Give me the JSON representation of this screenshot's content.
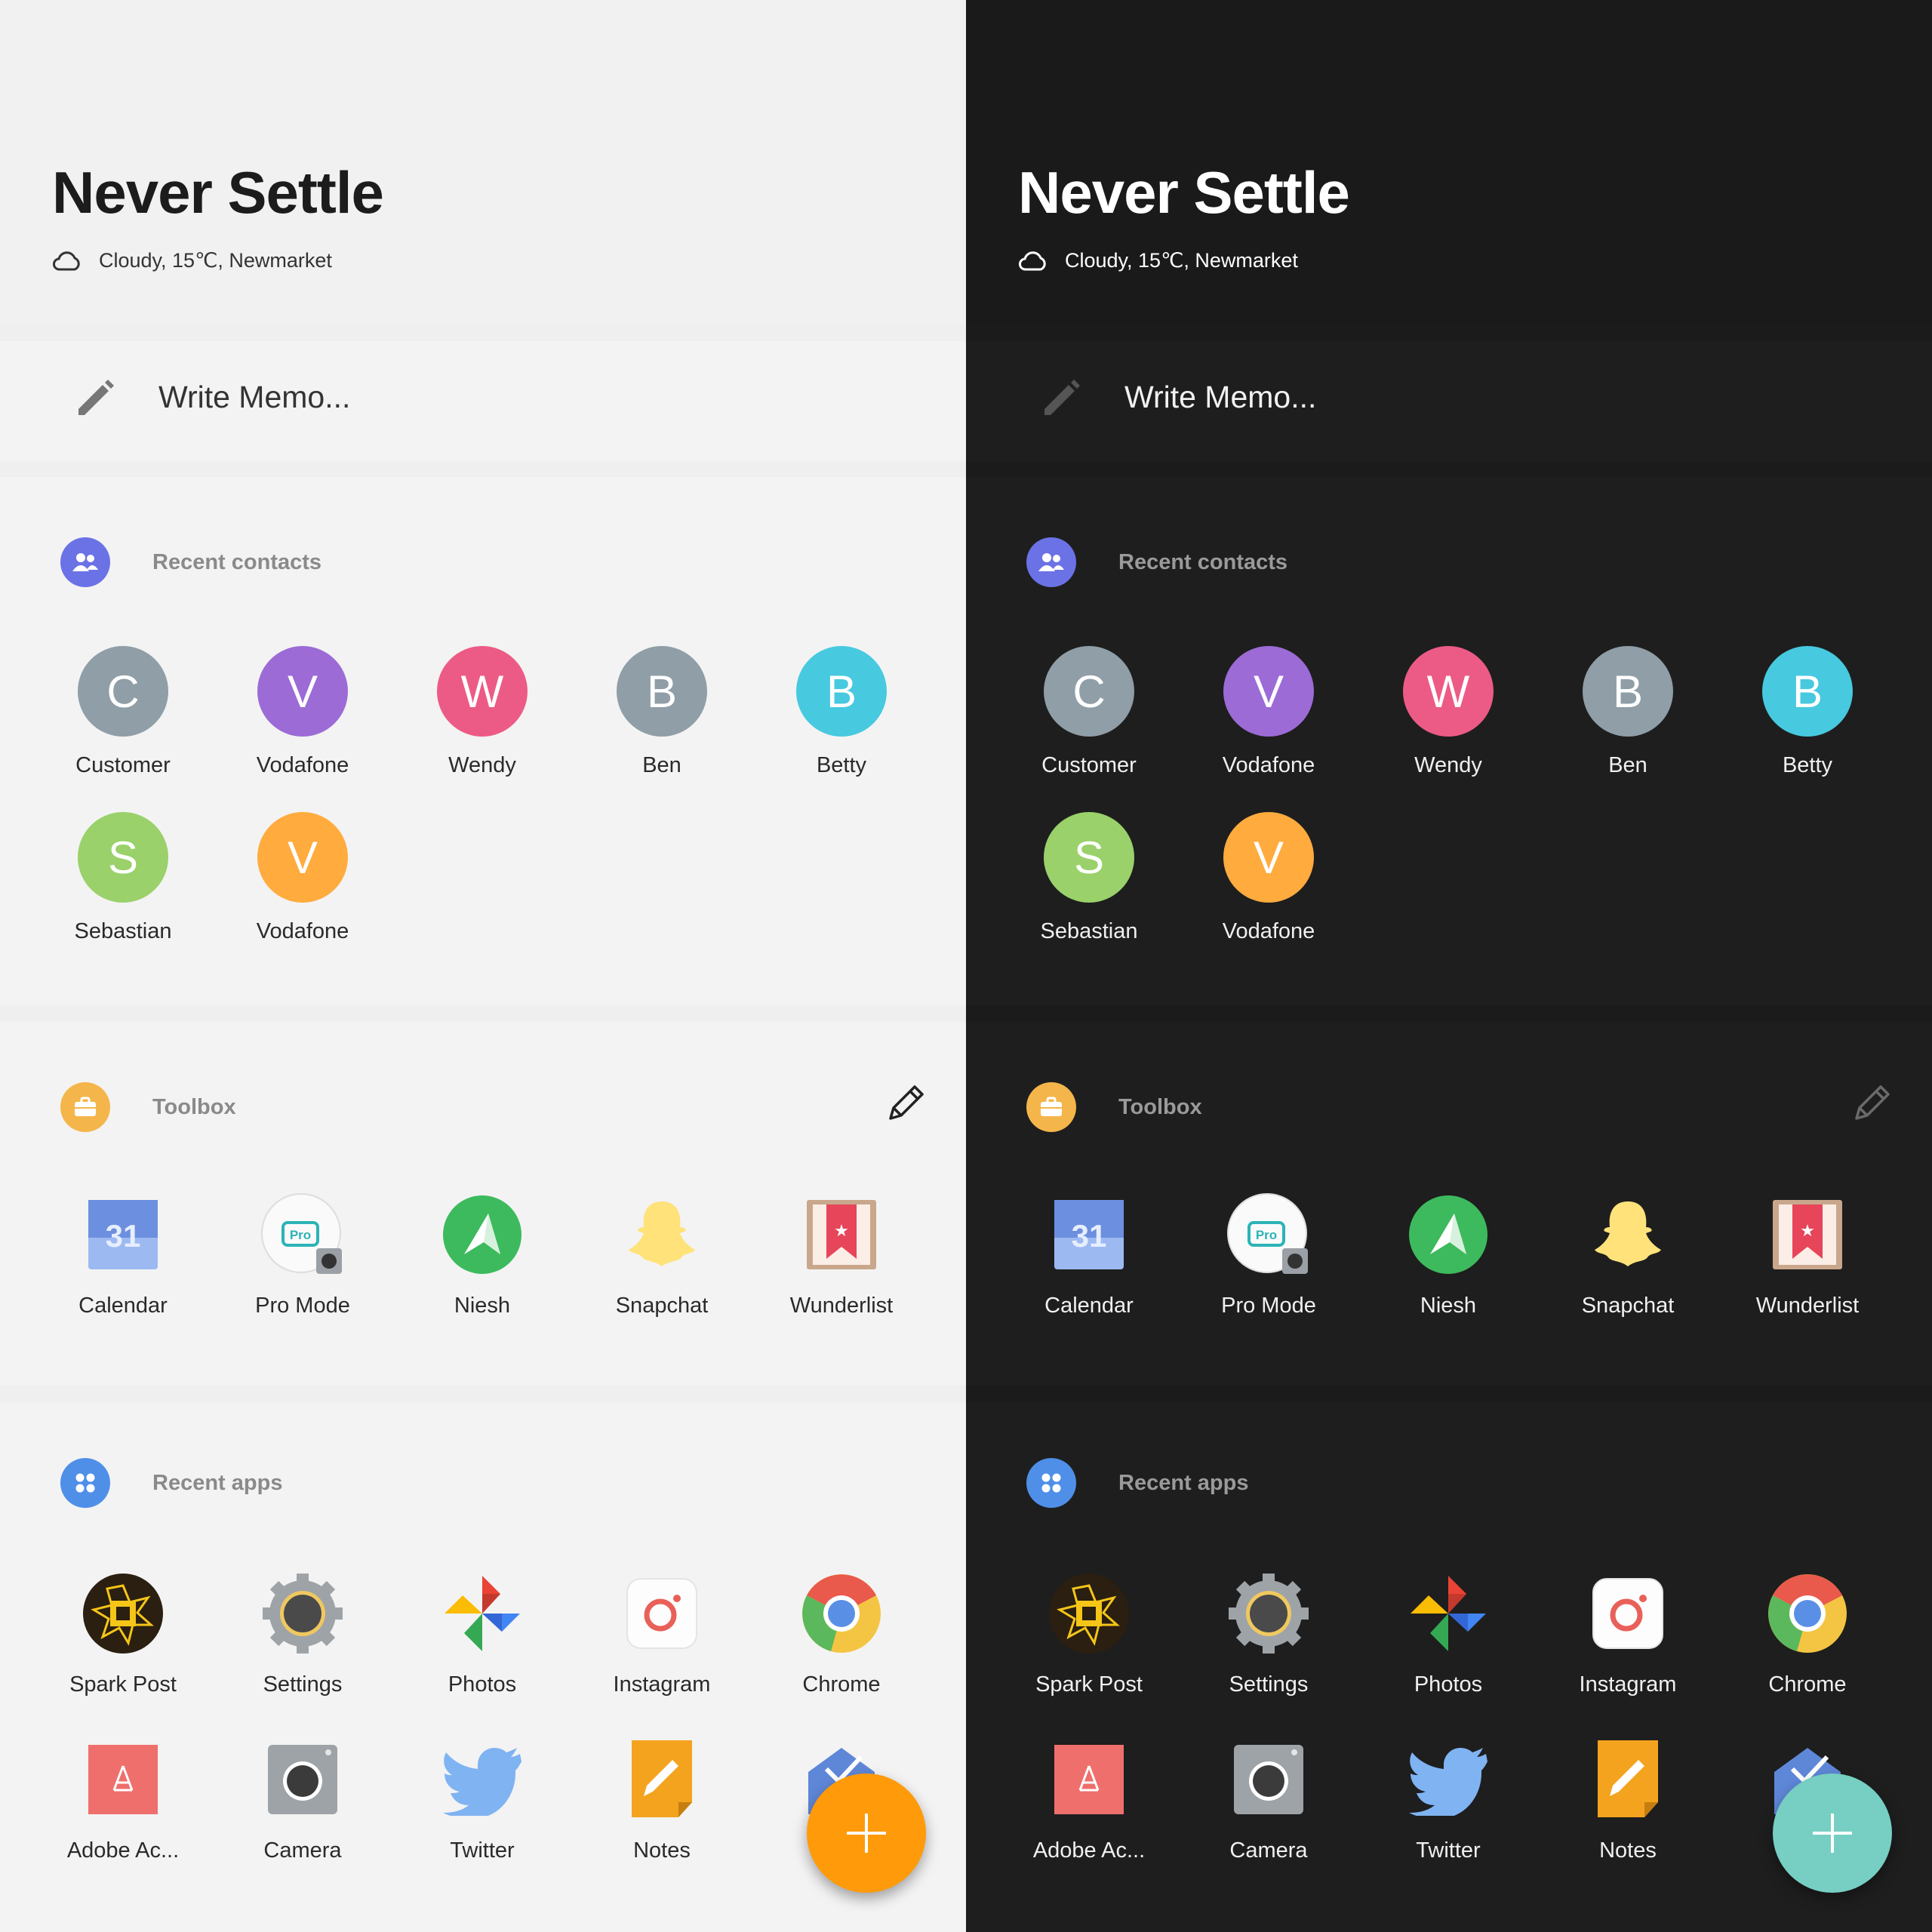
{
  "header": {
    "title": "Never Settle",
    "weather": "Cloudy, 15℃, Newmarket",
    "weather_icon": "cloud-icon"
  },
  "memo": {
    "placeholder": "Write Memo...",
    "icon": "pencil-icon"
  },
  "contacts": {
    "title": "Recent contacts",
    "icon": "people-icon",
    "icon_color": "#6b72e6",
    "items": [
      {
        "initial": "C",
        "name": "Customer",
        "color": "#8f9ea7"
      },
      {
        "initial": "V",
        "name": "Vodafone",
        "color": "#9c6bd6"
      },
      {
        "initial": "W",
        "name": "Wendy",
        "color": "#ec5b86"
      },
      {
        "initial": "B",
        "name": "Ben",
        "color": "#8f9ea7"
      },
      {
        "initial": "B",
        "name": "Betty",
        "color": "#47c9df"
      },
      {
        "initial": "S",
        "name": "Sebastian",
        "color": "#9ad16a"
      },
      {
        "initial": "V",
        "name": "Vodafone",
        "color": "#ffab3e"
      }
    ]
  },
  "toolbox": {
    "title": "Toolbox",
    "icon": "briefcase-icon",
    "icon_color": "#f4b64a",
    "edit_icon": "edit-pencil-icon",
    "items": [
      {
        "name": "Calendar",
        "icon": "calendar-icon",
        "number": "31"
      },
      {
        "name": "Pro Mode",
        "icon": "pro-mode-icon",
        "badge": "Pro"
      },
      {
        "name": "Niesh",
        "icon": "niesh-icon"
      },
      {
        "name": "Snapchat",
        "icon": "snapchat-icon"
      },
      {
        "name": "Wunderlist",
        "icon": "wunderlist-icon"
      }
    ]
  },
  "apps": {
    "title": "Recent apps",
    "icon": "apps-grid-icon",
    "icon_color": "#4f8fe8",
    "items": [
      {
        "name": "Spark Post",
        "icon": "spark-post-icon"
      },
      {
        "name": "Settings",
        "icon": "settings-gear-icon"
      },
      {
        "name": "Photos",
        "icon": "photos-pinwheel-icon"
      },
      {
        "name": "Instagram",
        "icon": "instagram-icon"
      },
      {
        "name": "Chrome",
        "icon": "chrome-icon"
      },
      {
        "name": "Adobe Ac...",
        "icon": "adobe-acrobat-icon"
      },
      {
        "name": "Camera",
        "icon": "camera-icon"
      },
      {
        "name": "Twitter",
        "icon": "twitter-bird-icon"
      },
      {
        "name": "Notes",
        "icon": "notes-icon"
      },
      {
        "name": "",
        "icon": "inbox-icon"
      }
    ]
  },
  "fab": {
    "icon": "plus-icon",
    "light_color": "#ff9a0a",
    "dark_color": "#76cfc2"
  }
}
